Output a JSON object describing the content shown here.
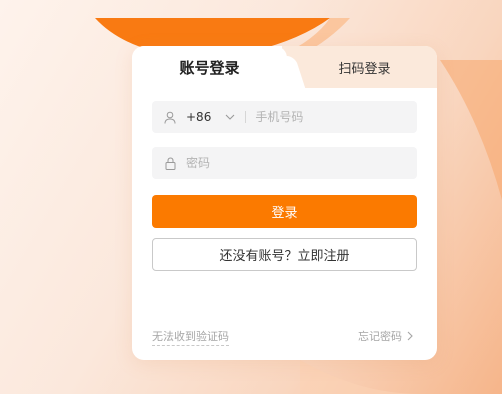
{
  "tabs": {
    "account_label": "账号登录",
    "qr_label": "扫码登录"
  },
  "phone": {
    "country_code": "+86",
    "placeholder": "手机号码",
    "value": ""
  },
  "password": {
    "placeholder": "密码",
    "value": ""
  },
  "buttons": {
    "login_label": "登录",
    "register_label": "还没有账号？立即注册"
  },
  "footer": {
    "no_code_label": "无法收到验证码",
    "forgot_label": "忘记密码"
  },
  "colors": {
    "accent": "#fb7a00",
    "card_bg": "#ffffff",
    "field_bg": "#f4f4f5"
  },
  "icons": {
    "phone_field": "user-icon",
    "password_field": "lock-icon",
    "country_dropdown": "chevron-down-icon",
    "forgot_arrow": "chevron-right-icon"
  }
}
